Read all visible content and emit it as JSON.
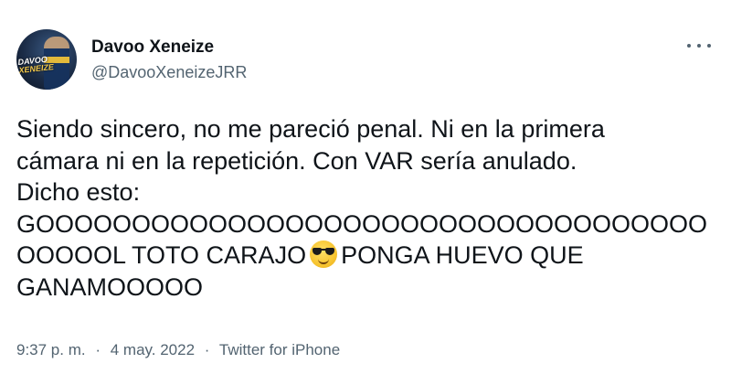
{
  "author": {
    "display_name": "Davoo Xeneize",
    "handle": "@DavooXeneizeJRR",
    "avatar_text_line1": "DAVOO",
    "avatar_text_line2": "XENEIZE"
  },
  "tweet": {
    "text_before_emoji": "Siendo sincero, no me pareció penal. Ni en la primera\ncámara ni en la repetición. Con VAR sería anulado.\nDicho esto:\nGOOOOOOOOOOOOOOOOOOOOOOOOOOOOOOOOOOO\nOOOOOL TOTO CARAJO",
    "emoji_name": "smiling-face-with-sunglasses",
    "text_after_emoji": "PONGA HUEVO QUE\nGANAMOOOOO"
  },
  "meta": {
    "time": "9:37 p. m.",
    "separator": "·",
    "date": "4 may. 2022",
    "source": "Twitter for iPhone"
  },
  "icons": {
    "more": "more-horizontal-icon"
  }
}
